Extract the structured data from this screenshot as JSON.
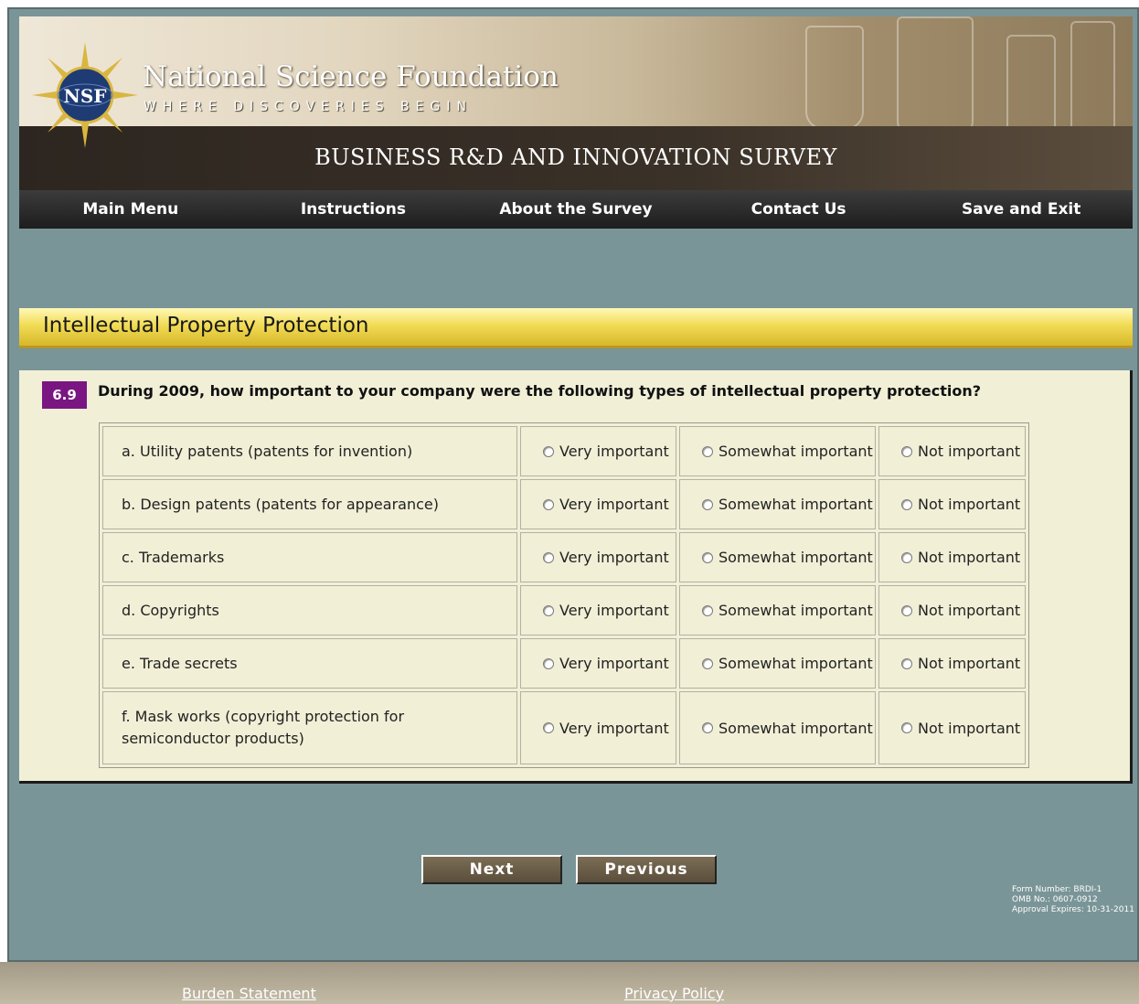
{
  "header": {
    "seal_label": "NSF",
    "org_name": "National Science Foundation",
    "tagline": "WHERE DISCOVERIES BEGIN",
    "survey_title": "BUSINESS R&D AND INNOVATION SURVEY"
  },
  "nav": {
    "items": [
      "Main Menu",
      "Instructions",
      "About the Survey",
      "Contact Us",
      "Save and Exit"
    ]
  },
  "section": {
    "title": "Intellectual Property Protection"
  },
  "question": {
    "number": "6.9",
    "text": "During 2009, how important to your company were the following types of intellectual property protection?",
    "options": [
      "Very important",
      "Somewhat important",
      "Not important"
    ],
    "rows": [
      "a. Utility patents (patents for invention)",
      "b. Design patents (patents for appearance)",
      "c. Trademarks",
      "d. Copyrights",
      "e. Trade secrets",
      "f. Mask works (copyright protection for semiconductor products)"
    ]
  },
  "buttons": {
    "next": "Next",
    "previous": "Previous"
  },
  "form_info": {
    "line1": "Form Number: BRDI-1",
    "line2": "OMB No.: 0607-0912",
    "line3": "Approval Expires: 10-31-2011"
  },
  "footer": {
    "burden": "Burden Statement",
    "privacy": "Privacy Policy"
  },
  "colors": {
    "background": "#7a9597",
    "panel": "#f1efd6",
    "question_badge": "#7a1682",
    "section_bar": "#f2dc55"
  }
}
